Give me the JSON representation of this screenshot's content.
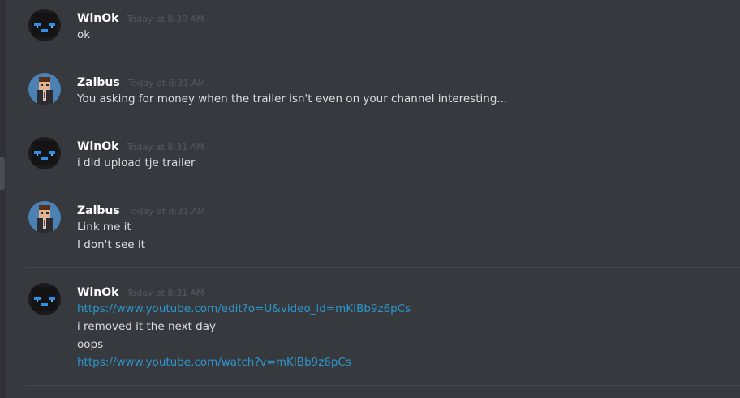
{
  "messages": [
    {
      "author": "WinOk",
      "avatar": "enderman-avatar-icon",
      "timestamp": "Today at 8:30 AM",
      "lines": [
        {
          "text": "ok",
          "is_link": false
        }
      ]
    },
    {
      "author": "Zalbus",
      "avatar": "character-avatar-icon",
      "timestamp": "Today at 8:31 AM",
      "lines": [
        {
          "text": "You asking for money when the trailer isn't even on your channel interesting...",
          "is_link": false
        }
      ]
    },
    {
      "author": "WinOk",
      "avatar": "enderman-avatar-icon",
      "timestamp": "Today at 8:31 AM",
      "lines": [
        {
          "text": "i did upload tje trailer",
          "is_link": false
        }
      ]
    },
    {
      "author": "Zalbus",
      "avatar": "character-avatar-icon",
      "timestamp": "Today at 8:31 AM",
      "lines": [
        {
          "text": "Link me it",
          "is_link": false
        },
        {
          "text": "I don't see it",
          "is_link": false
        }
      ]
    },
    {
      "author": "WinOk",
      "avatar": "enderman-avatar-icon",
      "timestamp": "Today at 8:31 AM",
      "lines": [
        {
          "text": "https://www.youtube.com/edit?o=U&video_id=mKIBb9z6pCs",
          "is_link": true
        },
        {
          "text": "i removed it the next day",
          "is_link": false
        },
        {
          "text": "oops",
          "is_link": false
        },
        {
          "text": "https://www.youtube.com/watch?v=mKIBb9z6pCs",
          "is_link": true
        }
      ]
    }
  ],
  "colors": {
    "background": "#36393e",
    "username": "#ffffff",
    "timestamp": "#55585d",
    "message_text": "#dcddde",
    "link": "#2e96cd",
    "divider": "#43464b"
  }
}
